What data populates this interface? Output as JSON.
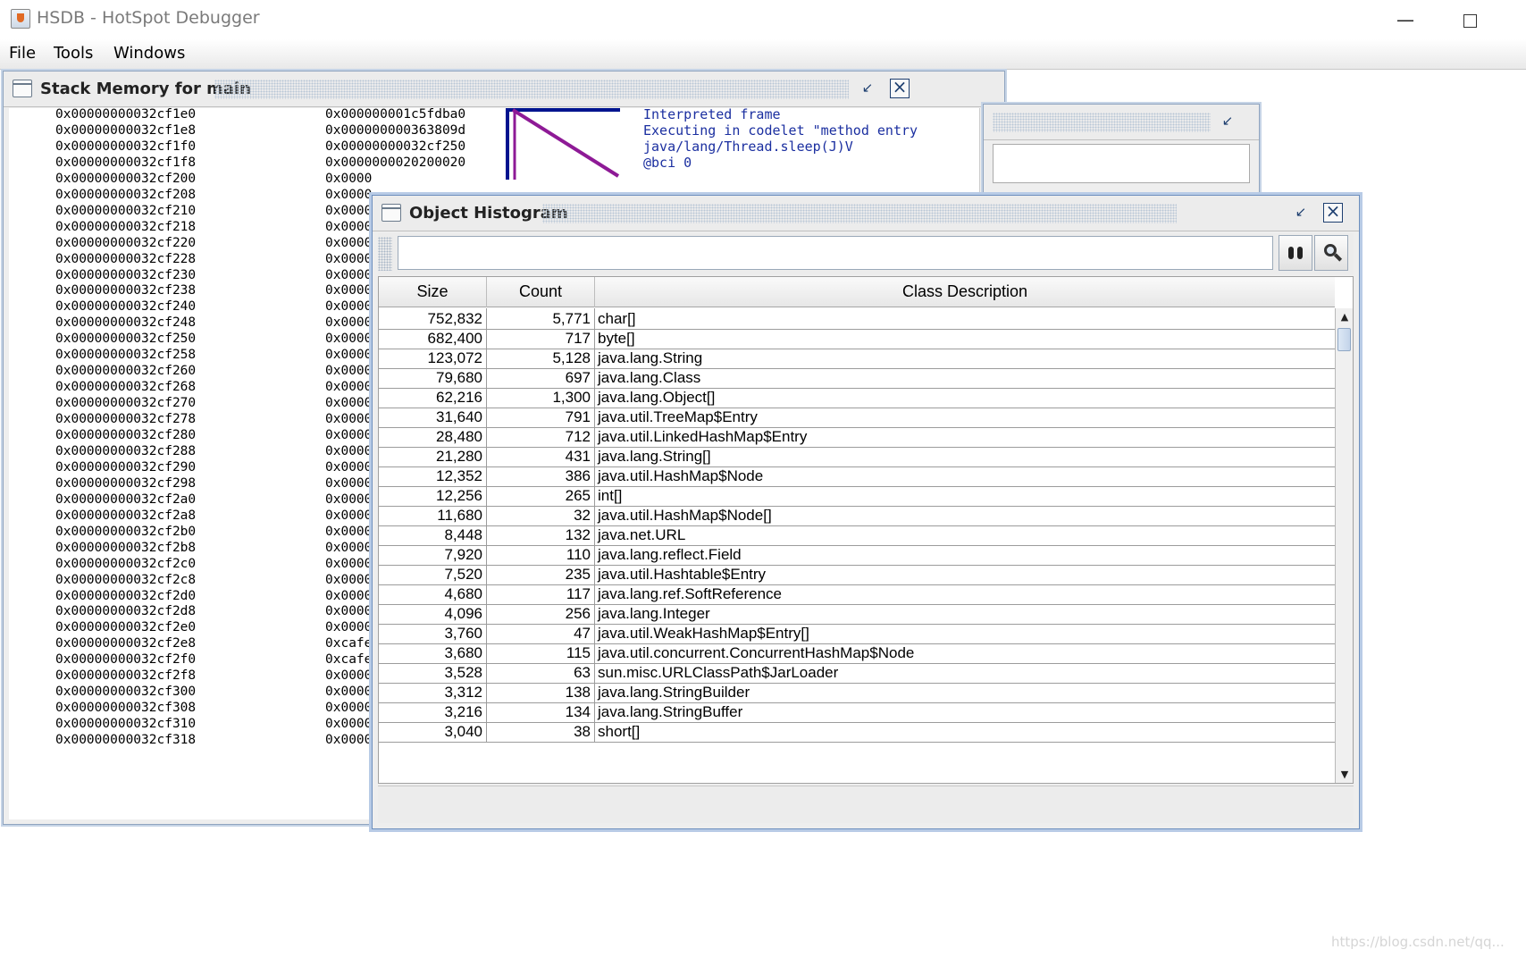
{
  "app": {
    "title": "HSDB - HotSpot Debugger",
    "minimize": "—"
  },
  "menubar": {
    "file": "File",
    "tools": "Tools",
    "windows": "Windows"
  },
  "stack_memory": {
    "title": "Stack Memory for main",
    "rows": [
      {
        "addr": "0x00000000032cf1e0",
        "val": "0x000000001c5fdba0"
      },
      {
        "addr": "0x00000000032cf1e8",
        "val": "0x000000000363809d"
      },
      {
        "addr": "0x00000000032cf1f0",
        "val": "0x00000000032cf250"
      },
      {
        "addr": "0x00000000032cf1f8",
        "val": "0x0000000020200020"
      },
      {
        "addr": "0x00000000032cf200",
        "val": "0x0000"
      },
      {
        "addr": "0x00000000032cf208",
        "val": "0x0000"
      },
      {
        "addr": "0x00000000032cf210",
        "val": "0x0000"
      },
      {
        "addr": "0x00000000032cf218",
        "val": "0x0000"
      },
      {
        "addr": "0x00000000032cf220",
        "val": "0x0000"
      },
      {
        "addr": "0x00000000032cf228",
        "val": "0x0000"
      },
      {
        "addr": "0x00000000032cf230",
        "val": "0x0000"
      },
      {
        "addr": "0x00000000032cf238",
        "val": "0x0000"
      },
      {
        "addr": "0x00000000032cf240",
        "val": "0x0000"
      },
      {
        "addr": "0x00000000032cf248",
        "val": "0x0000"
      },
      {
        "addr": "0x00000000032cf250",
        "val": "0x0000"
      },
      {
        "addr": "0x00000000032cf258",
        "val": "0x0000"
      },
      {
        "addr": "0x00000000032cf260",
        "val": "0x0000"
      },
      {
        "addr": "0x00000000032cf268",
        "val": "0x0000"
      },
      {
        "addr": "0x00000000032cf270",
        "val": "0x0000"
      },
      {
        "addr": "0x00000000032cf278",
        "val": "0x0000"
      },
      {
        "addr": "0x00000000032cf280",
        "val": "0x0000"
      },
      {
        "addr": "0x00000000032cf288",
        "val": "0x0000"
      },
      {
        "addr": "0x00000000032cf290",
        "val": "0x0000"
      },
      {
        "addr": "0x00000000032cf298",
        "val": "0x0000"
      },
      {
        "addr": "0x00000000032cf2a0",
        "val": "0x0000"
      },
      {
        "addr": "0x00000000032cf2a8",
        "val": "0x0000"
      },
      {
        "addr": "0x00000000032cf2b0",
        "val": "0x0000"
      },
      {
        "addr": "0x00000000032cf2b8",
        "val": "0x0000"
      },
      {
        "addr": "0x00000000032cf2c0",
        "val": "0x0000"
      },
      {
        "addr": "0x00000000032cf2c8",
        "val": "0x0000"
      },
      {
        "addr": "0x00000000032cf2d0",
        "val": "0x0000"
      },
      {
        "addr": "0x00000000032cf2d8",
        "val": "0x0000"
      },
      {
        "addr": "0x00000000032cf2e0",
        "val": "0x0000"
      },
      {
        "addr": "0x00000000032cf2e8",
        "val": "0xcafe"
      },
      {
        "addr": "0x00000000032cf2f0",
        "val": "0xcafe"
      },
      {
        "addr": "0x00000000032cf2f8",
        "val": "0x0000"
      },
      {
        "addr": "0x00000000032cf300",
        "val": "0x0000"
      },
      {
        "addr": "0x00000000032cf308",
        "val": "0x0000"
      },
      {
        "addr": "0x00000000032cf310",
        "val": "0x0000"
      },
      {
        "addr": "0x00000000032cf318",
        "val": "0x0000"
      }
    ],
    "annotations": [
      "Interpreted frame",
      "Executing in codelet \"method entry",
      "java/lang/Thread.sleep(J)V",
      "@bci 0"
    ],
    "colors": {
      "frame_line": "#00148f",
      "link_line": "#8e1a96",
      "annotation_text": "#1b2fa0"
    }
  },
  "histogram": {
    "title": "Object Histogram",
    "search_value": "",
    "find_icon": "binoculars-icon",
    "inspect_icon": "magnifier-icon",
    "columns": [
      "Size",
      "Count",
      "Class Description"
    ],
    "rows": [
      {
        "size": "752,832",
        "count": "5,771",
        "desc": "char[]"
      },
      {
        "size": "682,400",
        "count": "717",
        "desc": "byte[]"
      },
      {
        "size": "123,072",
        "count": "5,128",
        "desc": "java.lang.String"
      },
      {
        "size": "79,680",
        "count": "697",
        "desc": "java.lang.Class"
      },
      {
        "size": "62,216",
        "count": "1,300",
        "desc": "java.lang.Object[]"
      },
      {
        "size": "31,640",
        "count": "791",
        "desc": "java.util.TreeMap$Entry"
      },
      {
        "size": "28,480",
        "count": "712",
        "desc": "java.util.LinkedHashMap$Entry"
      },
      {
        "size": "21,280",
        "count": "431",
        "desc": "java.lang.String[]"
      },
      {
        "size": "12,352",
        "count": "386",
        "desc": "java.util.HashMap$Node"
      },
      {
        "size": "12,256",
        "count": "265",
        "desc": "int[]"
      },
      {
        "size": "11,680",
        "count": "32",
        "desc": "java.util.HashMap$Node[]"
      },
      {
        "size": "8,448",
        "count": "132",
        "desc": "java.net.URL"
      },
      {
        "size": "7,920",
        "count": "110",
        "desc": "java.lang.reflect.Field"
      },
      {
        "size": "7,520",
        "count": "235",
        "desc": "java.util.Hashtable$Entry"
      },
      {
        "size": "4,680",
        "count": "117",
        "desc": "java.lang.ref.SoftReference"
      },
      {
        "size": "4,096",
        "count": "256",
        "desc": "java.lang.Integer"
      },
      {
        "size": "3,760",
        "count": "47",
        "desc": "java.util.WeakHashMap$Entry[]"
      },
      {
        "size": "3,680",
        "count": "115",
        "desc": "java.util.concurrent.ConcurrentHashMap$Node"
      },
      {
        "size": "3,528",
        "count": "63",
        "desc": "sun.misc.URLClassPath$JarLoader"
      },
      {
        "size": "3,312",
        "count": "138",
        "desc": "java.lang.StringBuilder"
      },
      {
        "size": "3,216",
        "count": "134",
        "desc": "java.lang.StringBuffer"
      },
      {
        "size": "3,040",
        "count": "38",
        "desc": "short[]"
      }
    ]
  },
  "watermark": "https://blog.csdn.net/qq..."
}
